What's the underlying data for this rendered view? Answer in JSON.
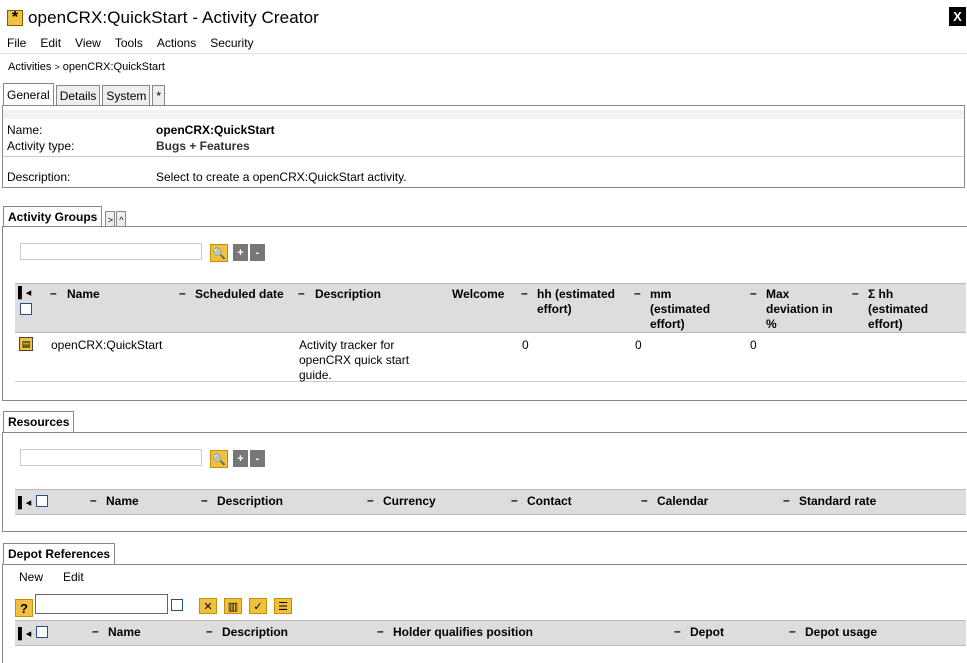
{
  "window": {
    "title": "openCRX:QuickStart - Activity Creator",
    "close_label": "X"
  },
  "menu": [
    "File",
    "Edit",
    "View",
    "Tools",
    "Actions",
    "Security"
  ],
  "breadcrumb": {
    "parent": "Activities",
    "separator": ">",
    "current": "openCRX:QuickStart"
  },
  "tabs": [
    "General",
    "Details",
    "System",
    "*"
  ],
  "general": {
    "name_label": "Name:",
    "name_value": "openCRX:QuickStart",
    "type_label": "Activity type:",
    "type_value": "Bugs + Features",
    "desc_label": "Description:",
    "desc_value": "Select to create a openCRX:QuickStart activity."
  },
  "activity_groups": {
    "tab_label": "Activity Groups",
    "nav_next": ">",
    "nav_up": "^",
    "search_placeholder": "",
    "add_label": "+",
    "remove_label": "-",
    "columns": [
      "Name",
      "Scheduled date",
      "Description",
      "Welcome",
      "hh (estimated effort)",
      "mm (estimated effort)",
      "Max deviation in %",
      "Σ hh (estimated effort)"
    ],
    "rows": [
      {
        "name": "openCRX:QuickStart",
        "scheduled_date": "",
        "description": "Activity tracker for openCRX quick start guide.",
        "welcome": "0",
        "hh": "0",
        "mm": "0",
        "max_dev": "",
        "sum_hh": ""
      }
    ]
  },
  "resources": {
    "tab_label": "Resources",
    "add_label": "+",
    "remove_label": "-",
    "columns": [
      "Name",
      "Description",
      "Currency",
      "Contact",
      "Calendar",
      "Standard rate"
    ]
  },
  "depot_references": {
    "tab_label": "Depot References",
    "menu": [
      "New",
      "Edit"
    ],
    "help_label": "?",
    "columns": [
      "Name",
      "Description",
      "Holder qualifies position",
      "Depot",
      "Depot usage"
    ]
  },
  "colors": {
    "accent_yellow": "#f0c040",
    "header_gray": "#dddddd",
    "checkbox_blue": "#2a4d8f"
  }
}
